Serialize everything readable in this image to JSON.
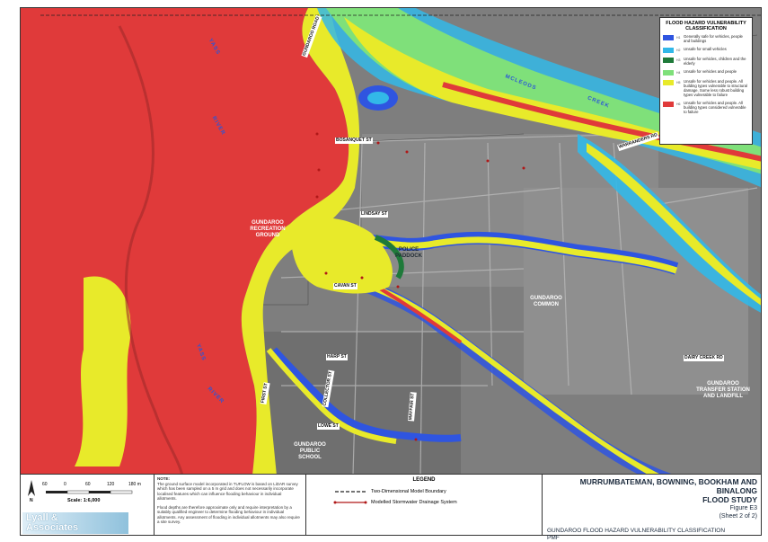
{
  "map": {
    "place_labels": {
      "recreation_ground": "GUNDAROO RECREATION GROUND",
      "police_paddock": "POLICE PADDOCK",
      "gundaroo_common": "GUNDAROO COMMON",
      "transfer_station": "GUNDAROO TRANSFER STATION AND LANDFILL",
      "public_school": "GUNDAROO PUBLIC SCHOOL"
    },
    "water_labels": {
      "yass_1": "YASS",
      "river_1": "RIVER",
      "yass_2": "YASS",
      "river_2": "RIVER",
      "mcleods": "MCLEODS",
      "creek": "CREEK"
    },
    "road_labels": {
      "road_a": "GUNDAROO ROAD",
      "road_b": "BOSANQUET ST",
      "road_c": "LINDSAY ST",
      "road_d": "CAVAN ST",
      "road_e": "HARP ST",
      "road_f": "WARRANDERS RD",
      "road_g": "DAIRY CREEK RD",
      "road_h": "COLLECTOR ST",
      "road_i": "FIRST ST",
      "road_j": "LOWE ST",
      "road_k": "MAYFAIR ST"
    }
  },
  "legend": {
    "title": "FLOOD HAZARD VULNERABILITY CLASSIFICATION",
    "items": [
      {
        "code": "H1",
        "color": "#2f55e0",
        "text": "Generally safe for vehicles, people and buildings"
      },
      {
        "code": "H2",
        "color": "#32b8e8",
        "text": "Unsafe for small vehicles"
      },
      {
        "code": "H3",
        "color": "#1f7a3a",
        "text": "Unsafe for vehicles, children and the elderly"
      },
      {
        "code": "H4",
        "color": "#7fe07a",
        "text": "Unsafe for vehicles and people"
      },
      {
        "code": "H5",
        "color": "#e8ea2a",
        "text": "Unsafe for vehicles and people. All building types vulnerable to structural damage. Some less robust building types vulnerable to failure"
      },
      {
        "code": "H6",
        "color": "#e03a3a",
        "text": "Unsafe for vehicles and people. All building types considered vulnerable to failure"
      }
    ]
  },
  "scale": {
    "ticks": [
      "60",
      "0",
      "60",
      "120",
      "180 m"
    ],
    "scale_text": "Scale: 1:6,000",
    "north": "N"
  },
  "note": {
    "heading": "NOTE:",
    "p1": "The ground surface model incorporated in TUFLOW is based on LiDAR survey which has been sampled on a 5 m grid and does not necessarily incorporate localised features which can influence flooding behaviour in individual allotments.",
    "p2": "Flood depths are therefore approximate only and require interpretation by a suitably qualified engineer to determine flooding behaviour in individual allotments. Any assessment of flooding in individual allotments may also require a site survey."
  },
  "footer_legend": {
    "heading": "LEGEND",
    "item1": "Two-Dimensional Model Boundary",
    "item2": "Modelled Stormwater Drainage System"
  },
  "logo": {
    "line1": "Lyall &",
    "line2": "Associates"
  },
  "title": {
    "line1": "MURRUMBATEMAN, BOWNING, BOOKHAM AND BINALONG",
    "line2": "FLOOD STUDY",
    "figure": "Figure E3",
    "sheet": "(Sheet 2 of 2)",
    "subtitle": "GUNDAROO FLOOD HAZARD VULNERABILITY CLASSIFICATION",
    "scenario": "PMF"
  },
  "colors": {
    "h6": "#e03a3a",
    "h5": "#e8ea2a",
    "h4": "#7fe07a",
    "h3": "#1f7a3a",
    "h2": "#32b8e8",
    "h1": "#2f55e0"
  }
}
